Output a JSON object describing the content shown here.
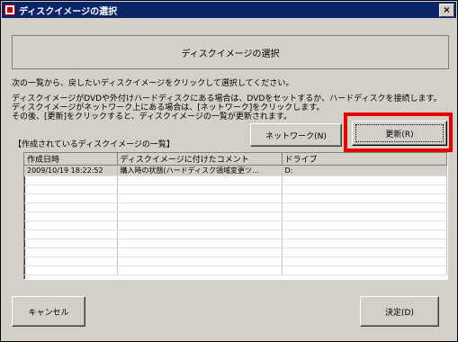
{
  "window": {
    "title": "ディスクイメージの選択",
    "close_glyph": "×"
  },
  "header": {
    "title": "ディスクイメージの選択"
  },
  "instructions": {
    "line1": "次の一覧から、戻したいディスクイメージをクリックして選択してください。",
    "line2": "ディスクイメージがDVDや外付けハードディスクにある場合は、DVDをセットするか、ハードディスクを接続します。",
    "line3": "ディスクイメージがネットワーク上にある場合は、[ネットワーク]をクリックします。",
    "line4": "その後、[更新]をクリックすると、ディスクイメージの一覧が更新されます。"
  },
  "list_title": "【作成されているディスクイメージの一覧】",
  "buttons": {
    "network": "ネットワーク(N)",
    "refresh": "更新(R)",
    "cancel": "キャンセル",
    "ok": "決定(D)"
  },
  "table": {
    "columns": [
      "作成日時",
      "ディスクイメージに付けたコメント",
      "ドライブ"
    ],
    "rows": [
      [
        "2009/10/19 18:22:52",
        "購入時の状態(ハードディスク領域変更ツ...",
        "D:"
      ]
    ]
  },
  "colors": {
    "title_bar": "#0a246a",
    "highlight_frame": "#e60000",
    "dialog_bg": "#d4d0c8"
  }
}
